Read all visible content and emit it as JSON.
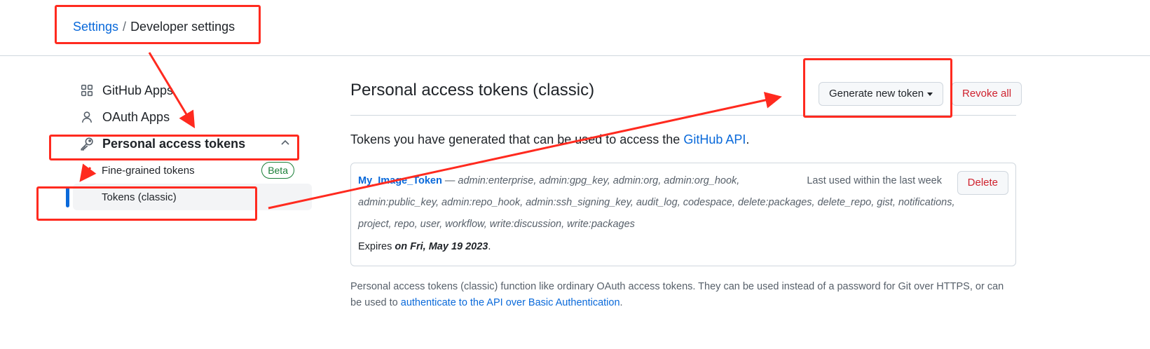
{
  "breadcrumb": {
    "root": "Settings",
    "separator": "/",
    "current": "Developer settings"
  },
  "sidebar": {
    "items": [
      {
        "label": "GitHub Apps",
        "icon": "apps-grid-icon"
      },
      {
        "label": "OAuth Apps",
        "icon": "person-icon"
      },
      {
        "label": "Personal access tokens",
        "icon": "key-icon",
        "expanded": true
      }
    ],
    "subitems": [
      {
        "label": "Fine-grained tokens",
        "badge": "Beta"
      },
      {
        "label": "Tokens (classic)",
        "active": true
      }
    ]
  },
  "main": {
    "title": "Personal access tokens (classic)",
    "generate_button": "Generate new token",
    "revoke_button": "Revoke all",
    "intro_text": "Tokens you have generated that can be used to access the ",
    "intro_link": "GitHub API",
    "intro_end": ".",
    "token": {
      "name": "My_Image_Token",
      "dash": " — ",
      "scopes_line1": "admin:enterprise, admin:gpg_key, admin:org, admin:org_hook,",
      "scopes_line2": "admin:public_key, admin:repo_hook, admin:ssh_signing_key, audit_log, codespace, delete:packages, delete_repo, gist, notifications,",
      "scopes_line3": "project, repo, user, workflow, write:discussion, write:packages",
      "last_used": "Last used within the last week",
      "delete_button": "Delete",
      "expires_prefix": "Expires ",
      "expires_date": "on Fri, May 19 2023",
      "expires_suffix": "."
    },
    "footnote_text": "Personal access tokens (classic) function like ordinary OAuth access tokens. They can be used instead of a password for Git over HTTPS, or can be used to ",
    "footnote_link": "authenticate to the API over Basic Authentication",
    "footnote_end": "."
  },
  "colors": {
    "link": "#0969da",
    "danger": "#cf222e",
    "annotation": "#ff2a1f",
    "success": "#1a7f37"
  }
}
